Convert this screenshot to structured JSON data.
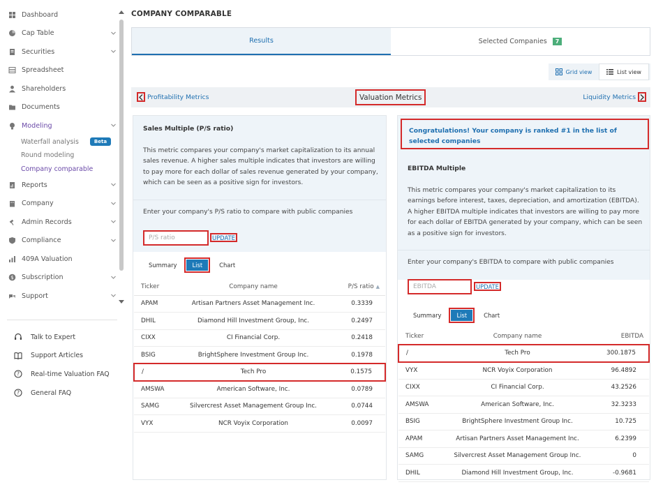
{
  "sidebar": {
    "items": [
      {
        "label": "Dashboard",
        "icon": "dashboard-icon",
        "chevron": false
      },
      {
        "label": "Cap Table",
        "icon": "pie-chart-icon",
        "chevron": true
      },
      {
        "label": "Securities",
        "icon": "document-icon",
        "chevron": true
      },
      {
        "label": "Spreadsheet",
        "icon": "grid-icon",
        "chevron": false
      },
      {
        "label": "Shareholders",
        "icon": "person-icon",
        "chevron": false
      },
      {
        "label": "Documents",
        "icon": "folder-icon",
        "chevron": false
      },
      {
        "label": "Modeling",
        "icon": "lightbulb-icon",
        "chevron": true
      }
    ],
    "modeling_sub": [
      {
        "label": "Waterfall analysis",
        "badge": "Beta"
      },
      {
        "label": "Round modeling"
      },
      {
        "label": "Company comparable"
      }
    ],
    "items_after": [
      {
        "label": "Reports",
        "icon": "report-icon",
        "chevron": true
      },
      {
        "label": "Company",
        "icon": "building-icon",
        "chevron": true
      },
      {
        "label": "Admin Records",
        "icon": "gavel-icon",
        "chevron": true
      },
      {
        "label": "Compliance",
        "icon": "shield-icon",
        "chevron": true
      },
      {
        "label": "409A Valuation",
        "icon": "valuation-icon",
        "chevron": false
      },
      {
        "label": "Subscription",
        "icon": "dollar-icon",
        "chevron": true
      },
      {
        "label": "Support",
        "icon": "support-icon",
        "chevron": true
      }
    ],
    "help": [
      {
        "label": "Talk to Expert",
        "icon": "headset-icon"
      },
      {
        "label": "Support Articles",
        "icon": "book-icon"
      },
      {
        "label": "Real-time Valuation FAQ",
        "icon": "question-icon"
      },
      {
        "label": "General FAQ",
        "icon": "question-icon"
      }
    ]
  },
  "page": {
    "title": "COMPANY COMPARABLE"
  },
  "tabs": {
    "results": "Results",
    "selected": "Selected Companies",
    "selected_count": "7"
  },
  "view": {
    "grid": "Grid view",
    "list": "List view"
  },
  "metric_nav": {
    "left": "Profitability Metrics",
    "center": "Valuation Metrics",
    "right": "Liquidity Metrics"
  },
  "left_panel": {
    "heading": "Sales Multiple (P/S ratio)",
    "description": "This metric compares your company's market capitalization to its annual sales revenue. A higher sales multiple indicates that investors are willing to pay more for each dollar of sales revenue generated by your company, which can be seen as a positive sign for investors.",
    "prompt": "Enter your company's P/S ratio to compare with public companies",
    "input_placeholder": "P/S ratio",
    "update": "UPDATE",
    "subtabs": [
      "Summary",
      "List",
      "Chart"
    ],
    "columns": [
      "Ticker",
      "Company name",
      "P/S ratio"
    ],
    "rows": [
      [
        "APAM",
        "Artisan Partners Asset Management Inc.",
        "0.3339"
      ],
      [
        "DHIL",
        "Diamond Hill Investment Group, Inc.",
        "0.2497"
      ],
      [
        "CIXX",
        "CI Financial Corp.",
        "0.2418"
      ],
      [
        "BSIG",
        "BrightSphere Investment Group Inc.",
        "0.1978"
      ],
      [
        "/",
        "Tech Pro",
        "0.1575"
      ],
      [
        "AMSWA",
        "American Software, Inc.",
        "0.0789"
      ],
      [
        "SAMG",
        "Silvercrest Asset Management Group Inc.",
        "0.0744"
      ],
      [
        "VYX",
        "NCR Voyix Corporation",
        "0.0097"
      ]
    ],
    "highlight_index": 4
  },
  "right_panel": {
    "congrats": "Congratulations! Your company is ranked #1 in the list of selected companies",
    "heading": "EBITDA Multiple",
    "description": "This metric compares your company's market capitalization to its earnings before interest, taxes, depreciation, and amortization (EBITDA). A higher EBITDA multiple indicates that investors are willing to pay more for each dollar of EBITDA generated by your company, which can be seen as a positive sign for investors.",
    "prompt": "Enter your company's EBITDA to compare with public companies",
    "input_placeholder": "EBITDA",
    "update": "UPDATE",
    "subtabs": [
      "Summary",
      "List",
      "Chart"
    ],
    "columns": [
      "Ticker",
      "Company name",
      "EBITDA"
    ],
    "rows": [
      [
        "/",
        "Tech Pro",
        "300.1875"
      ],
      [
        "VYX",
        "NCR Voyix Corporation",
        "96.4892"
      ],
      [
        "CIXX",
        "CI Financial Corp.",
        "43.2526"
      ],
      [
        "AMSWA",
        "American Software, Inc.",
        "32.3233"
      ],
      [
        "BSIG",
        "BrightSphere Investment Group Inc.",
        "10.725"
      ],
      [
        "APAM",
        "Artisan Partners Asset Management Inc.",
        "6.2399"
      ],
      [
        "SAMG",
        "Silvercrest Asset Management Group Inc.",
        "0"
      ],
      [
        "DHIL",
        "Diamond Hill Investment Group, Inc.",
        "-0.9681"
      ]
    ],
    "highlight_index": 0
  },
  "colors": {
    "accent": "#1e6fb0",
    "active_nav": "#6b4aa8",
    "highlight": "#d42a2a",
    "badge": "#4cae7a"
  }
}
